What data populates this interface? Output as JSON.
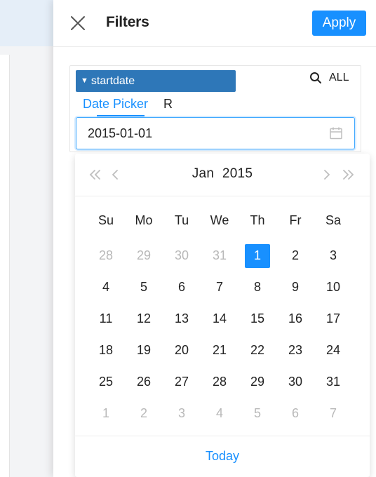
{
  "drawer": {
    "title": "Filters",
    "apply_label": "Apply"
  },
  "filter": {
    "field_name": "startdate",
    "search_all_label": "ALL",
    "tabs": [
      "Date Picker",
      "R"
    ],
    "active_tab": "Date Picker",
    "date_value": "2015-01-01"
  },
  "calendar": {
    "month": "Jan",
    "year": "2015",
    "weekdays": [
      "Su",
      "Mo",
      "Tu",
      "We",
      "Th",
      "Fr",
      "Sa"
    ],
    "weeks": [
      [
        "28",
        "29",
        "30",
        "31",
        "1",
        "2",
        "3"
      ],
      [
        "4",
        "5",
        "6",
        "7",
        "8",
        "9",
        "10"
      ],
      [
        "11",
        "12",
        "13",
        "14",
        "15",
        "16",
        "17"
      ],
      [
        "18",
        "19",
        "20",
        "21",
        "22",
        "23",
        "24"
      ],
      [
        "25",
        "26",
        "27",
        "28",
        "29",
        "30",
        "31"
      ],
      [
        "1",
        "2",
        "3",
        "4",
        "5",
        "6",
        "7"
      ]
    ],
    "selected_day": "1",
    "today_label": "Today"
  },
  "colors": {
    "accent": "#1890ff",
    "field_tag": "#2e77b8",
    "muted_text": "#b8b8b8"
  },
  "icons": {
    "close": "close-icon",
    "search": "search-icon",
    "calendar": "calendar-icon",
    "prev_year": "double-chevron-left-icon",
    "prev_month": "chevron-left-icon",
    "next_month": "chevron-right-icon",
    "next_year": "double-chevron-right-icon",
    "field_caret": "caret-down-icon"
  }
}
